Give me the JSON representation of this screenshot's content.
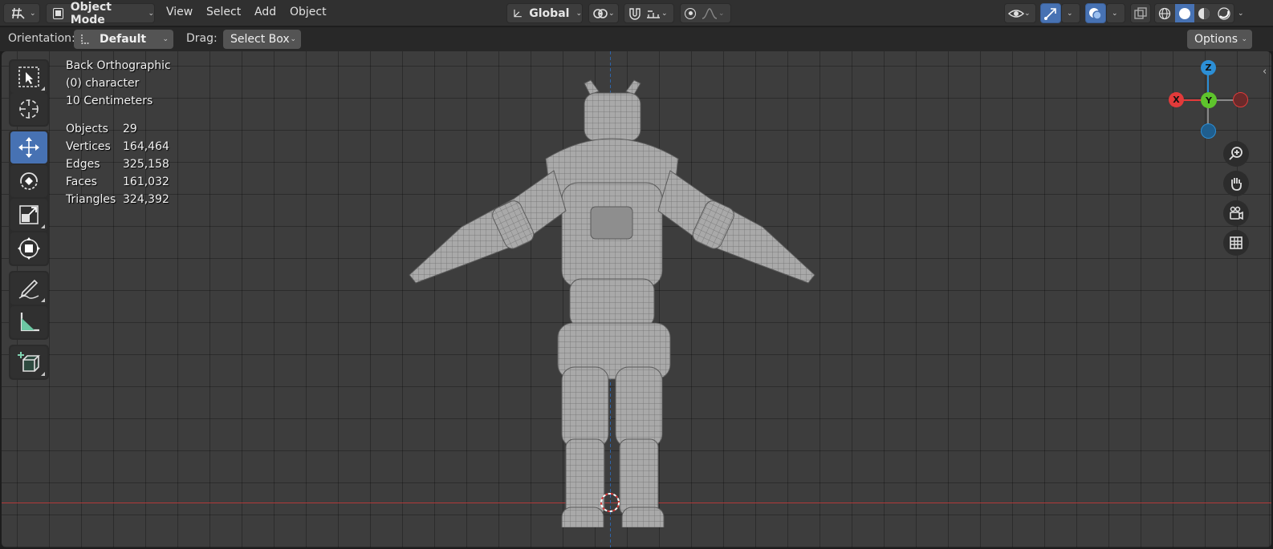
{
  "header": {
    "editor_type_icon": "grid-editor-icon",
    "mode_label": "Object Mode",
    "menus": [
      "View",
      "Select",
      "Add",
      "Object"
    ],
    "transform_orientation": "Global",
    "pivot_icon": "pivot-icon",
    "snap_icon": "magnet-icon",
    "proportional_icon": "proportional-edit-icon"
  },
  "tool_settings": {
    "orientation_label": "Orientation:",
    "orientation_value": "Default",
    "drag_label": "Drag:",
    "drag_value": "Select Box",
    "options_label": "Options"
  },
  "viewport": {
    "view_name": "Back Orthographic",
    "collection_line": "(0) character",
    "grid_scale": "10 Centimeters",
    "stats": [
      {
        "label": "Objects",
        "value": "29"
      },
      {
        "label": "Vertices",
        "value": "164,464"
      },
      {
        "label": "Edges",
        "value": "325,158"
      },
      {
        "label": "Faces",
        "value": "161,032"
      },
      {
        "label": "Triangles",
        "value": "324,392"
      }
    ],
    "gizmo": {
      "x_label": "X",
      "y_label": "Y",
      "z_label": "Z",
      "x_color": "#e23a3a",
      "y_color": "#5ec42c",
      "z_color": "#2c8fd6"
    }
  },
  "tools": [
    {
      "name": "select-box-tool",
      "icon": "select-box-icon",
      "active": false
    },
    {
      "name": "cursor-tool",
      "icon": "cursor-icon",
      "active": false
    },
    {
      "name": "move-tool",
      "icon": "move-icon",
      "active": true
    },
    {
      "name": "rotate-tool",
      "icon": "rotate-icon",
      "active": false
    },
    {
      "name": "scale-tool",
      "icon": "scale-icon",
      "active": false
    },
    {
      "name": "transform-tool",
      "icon": "transform-icon",
      "active": false
    },
    {
      "name": "annotate-tool",
      "icon": "annotate-icon",
      "active": false
    },
    {
      "name": "measure-tool",
      "icon": "measure-icon",
      "active": false
    },
    {
      "name": "add-cube-tool",
      "icon": "add-cube-icon",
      "active": false
    }
  ],
  "colors": {
    "accent": "#4772b3",
    "grid_bg": "#3d3d3d",
    "header": "#303030"
  }
}
